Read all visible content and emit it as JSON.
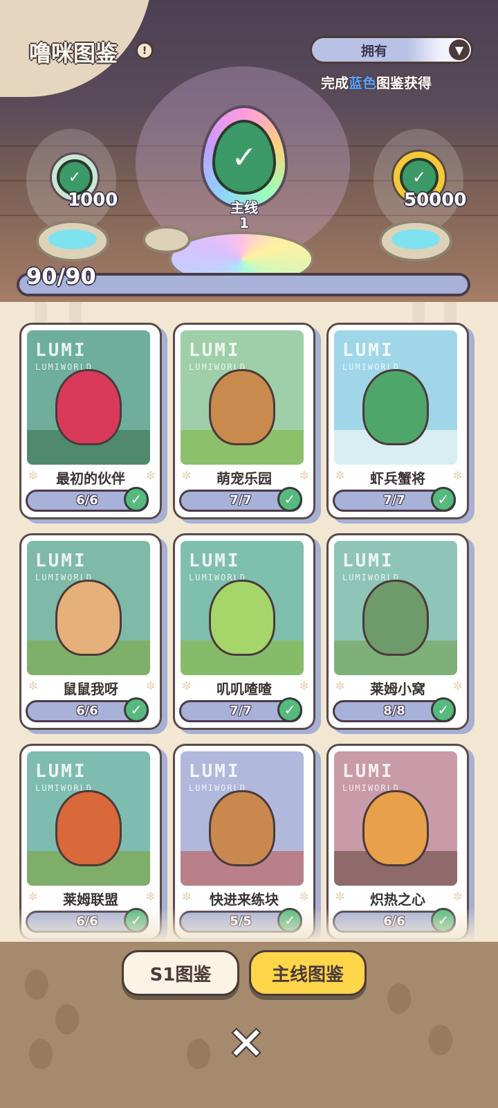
{
  "header": {
    "title": "噜咪图鉴",
    "info_icon": "!",
    "filter": {
      "selected": "拥有"
    },
    "reward_hint_prefix": "完成",
    "reward_hint_color_word": "蓝色",
    "reward_hint_suffix": "图鉴获得"
  },
  "rewards": {
    "left_value": "1000",
    "main_label": "主线",
    "main_level": "1",
    "right_value": "50000"
  },
  "progress": {
    "text": "90/90",
    "fraction": 1.0
  },
  "cards": [
    {
      "name": "最初的伙伴",
      "count": "6/6"
    },
    {
      "name": "萌宠乐园",
      "count": "7/7"
    },
    {
      "name": "虾兵蟹将",
      "count": "7/7"
    },
    {
      "name": "鼠鼠我呀",
      "count": "6/6"
    },
    {
      "name": "叽叽喳喳",
      "count": "7/7"
    },
    {
      "name": "莱姆小窝",
      "count": "8/8"
    },
    {
      "name": "莱姆联盟",
      "count": "6/6"
    },
    {
      "name": "快进来练块",
      "count": "5/5"
    },
    {
      "name": "炽热之心",
      "count": "6/6"
    }
  ],
  "card_logo": "LUMI",
  "card_logo_sub": "LUMIWORLD",
  "tabs": {
    "s1": "S1图鉴",
    "main": "主线图鉴"
  },
  "close_label": "✕",
  "colors": {
    "accent_blue": "#5aa0ff",
    "check_green": "#56b97e",
    "tab_active": "#ffd54a"
  }
}
